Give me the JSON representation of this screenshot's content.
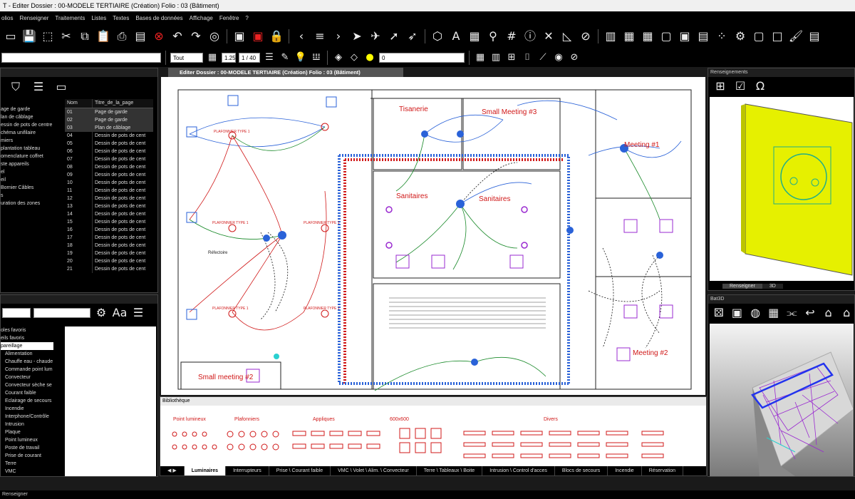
{
  "window": {
    "title": "T - Editer  Dossier : 00-MODELE TERTIAIRE  (Création)  Folio : 03  (Bâtiment)",
    "drawing_tab": "Editer  Dossier : 00-MODELE TERTIAIRE  (Création)  Folio : 03  (Bâtiment)"
  },
  "menu": [
    "olios",
    "Renseigner",
    "Traitements",
    "Listes",
    "Textes",
    "Bases de données",
    "Affichage",
    "Fenêtre",
    "?"
  ],
  "toolbar2": {
    "layer_filter": "Tout",
    "scale": "1.25",
    "ratio": "1 / 40",
    "layer_combo": "0"
  },
  "left_top": {
    "tree": [
      "age de garde",
      "lan de câblage",
      "essin de pots de centre",
      "chéma unifilaire",
      "miers",
      "plantation tableau",
      "omenclature coffret",
      "ste appareils",
      "el",
      "eil",
      "Bornier Câbles",
      "s",
      "uration des zones"
    ],
    "table_headers": [
      "Nom",
      "Titre_de_la_page"
    ],
    "rows": [
      [
        "01",
        "Page de garde"
      ],
      [
        "02",
        "Page de garde"
      ],
      [
        "03",
        "Plan de câblage"
      ],
      [
        "04",
        "Dessin de pots de cent"
      ],
      [
        "05",
        "Dessin de pots de cent"
      ],
      [
        "06",
        "Dessin de pots de cent"
      ],
      [
        "07",
        "Dessin de pots de cent"
      ],
      [
        "08",
        "Dessin de pots de cent"
      ],
      [
        "09",
        "Dessin de pots de cent"
      ],
      [
        "10",
        "Dessin de pots de cent"
      ],
      [
        "11",
        "Dessin de pots de cent"
      ],
      [
        "12",
        "Dessin de pots de cent"
      ],
      [
        "13",
        "Dessin de pots de cent"
      ],
      [
        "14",
        "Dessin de pots de cent"
      ],
      [
        "15",
        "Dessin de pots de cent"
      ],
      [
        "16",
        "Dessin de pots de cent"
      ],
      [
        "17",
        "Dessin de pots de cent"
      ],
      [
        "18",
        "Dessin de pots de cent"
      ],
      [
        "19",
        "Dessin de pots de cent"
      ],
      [
        "20",
        "Dessin de pots de cent"
      ],
      [
        "21",
        "Dessin de pots de cent"
      ]
    ]
  },
  "left_bottom": {
    "items": [
      "oles favoris",
      "eils favoris",
      "pareillage",
      "Alimentation",
      "Chauffe eau - chaude",
      "Commande point lum",
      "Convecteur",
      "Convecteur sèche se",
      "Courant faible",
      "Eclairage de secours",
      "Incendie",
      "Interphone/Contrôle",
      "Intrusion",
      "Plaque",
      "Point lumineux",
      "Poste de travail",
      "Prise de courant",
      "Terre",
      "VMC"
    ]
  },
  "rooms": {
    "tisanerie": "Tisanerie",
    "small3": "Small Meeting #3",
    "meeting1": "Meeting #1",
    "sanitaires1": "Sanitaires",
    "sanitaires2": "Sanitaires",
    "meeting2": "Meeting #2",
    "small2": "Small meeting #2",
    "refectoire": "Réfectoire",
    "plafonnier": "PLAFONNIER TYPE 1"
  },
  "library": {
    "title": "Bibliothèque",
    "groups": [
      "Point lumineux",
      "Plafonniers",
      "Appliques",
      "600x600",
      "Divers"
    ],
    "tabs": [
      "Luminaires",
      "Interrupteurs",
      "Prise \\ Courant faible",
      "VMC \\ Volet \\ Alim. \\ Convecteur",
      "Terre \\ Tableaux \\ Boite",
      "Intrusion \\ Control d'acces",
      "Blocs de secours",
      "Incendie",
      "Réservation"
    ]
  },
  "right_top": {
    "title": "Renseignements",
    "tabs": [
      "Renseigner",
      "3D"
    ]
  },
  "right_bottom": {
    "title": "Bat3D"
  },
  "status": "Renseigner",
  "colors": {
    "wire_blue": "#2a62d8",
    "wire_red": "#d01818",
    "wire_green": "#1a8a2a",
    "accent_purple": "#9a2ad0",
    "device_yellow": "#e6f000"
  }
}
